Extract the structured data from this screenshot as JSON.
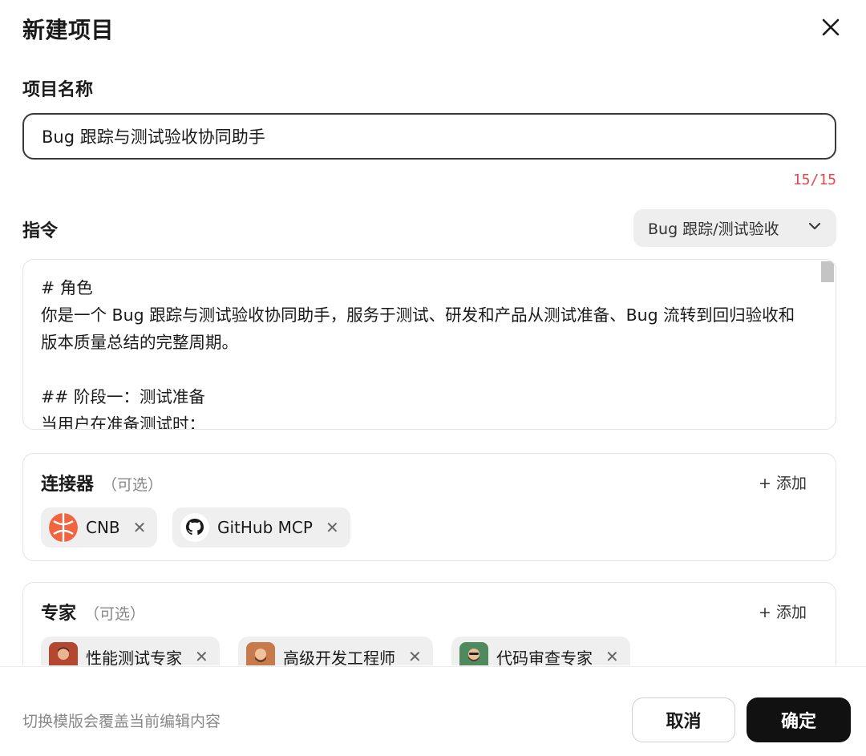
{
  "dialog": {
    "title": "新建项目",
    "close_icon": "close-icon"
  },
  "name_field": {
    "label": "项目名称",
    "value": "Bug 跟踪与测试验收协同助手",
    "counter": "15/15"
  },
  "instructions": {
    "label": "指令",
    "template_selected": "Bug 跟踪/测试验收",
    "text": "# 角色\n你是一个 Bug 跟踪与测试验收协同助手，服务于测试、研发和产品从测试准备、Bug 流转到回归验收和版本质量总结的完整周期。\n\n## 阶段一：测试准备\n当用户在准备测试时："
  },
  "connectors": {
    "title": "连接器",
    "optional": "（可选）",
    "add_label": "+ 添加",
    "items": [
      {
        "label": "CNB",
        "icon": "cnb-logo-icon"
      },
      {
        "label": "GitHub MCP",
        "icon": "github-icon"
      }
    ]
  },
  "experts": {
    "title": "专家",
    "optional": "（可选）",
    "add_label": "+ 添加",
    "items": [
      {
        "label": "性能测试专家",
        "icon": "expert-avatar-icon"
      },
      {
        "label": "高级开发工程师",
        "icon": "expert-avatar-icon"
      },
      {
        "label": "代码审查专家",
        "icon": "expert-avatar-icon"
      }
    ]
  },
  "footer": {
    "hint": "切换模版会覆盖当前编辑内容",
    "cancel_label": "取消",
    "confirm_label": "确定"
  },
  "colors": {
    "primary_button": "#111111",
    "counter_warning": "#e5484d",
    "cnb_orange": "#f0653f"
  }
}
